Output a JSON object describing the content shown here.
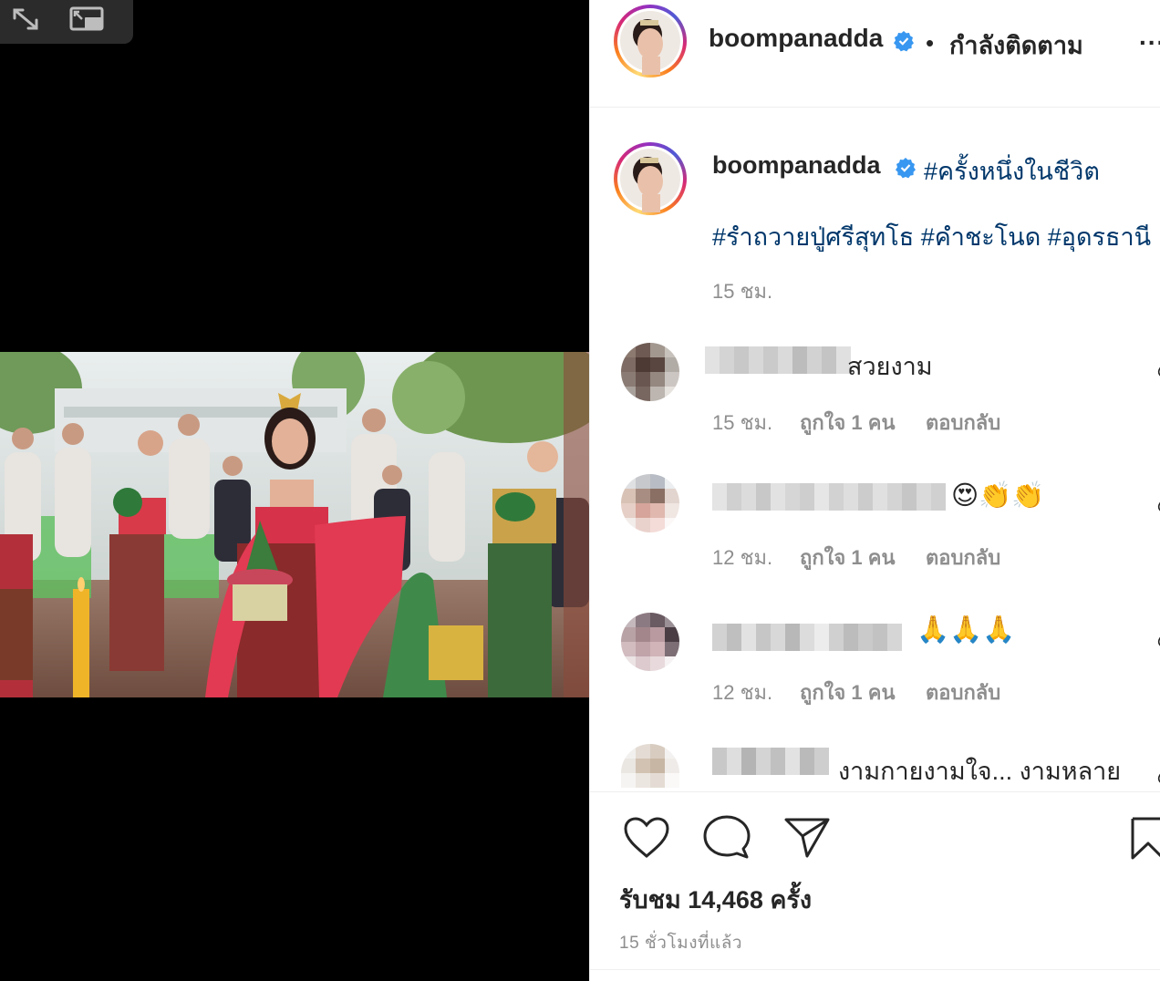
{
  "post": {
    "username": "boompanadda",
    "follow_separator": "•",
    "follow_status": "กำลังติดตาม",
    "more_label": "...",
    "caption_line1": "#ครั้งหนึ่งในชีวิต",
    "caption_line2": "#รำถวายปู่ศรีสุทโธ #คำชะโนด #อุดรธานี",
    "caption_time": "15 ชม."
  },
  "comments": [
    {
      "text": "สวยงาม",
      "time": "15 ชม.",
      "likes": "ถูกใจ 1 คน",
      "reply": "ตอบกลับ"
    },
    {
      "text": "😍👏👏",
      "time": "12 ชม.",
      "likes": "ถูกใจ 1 คน",
      "reply": "ตอบกลับ"
    },
    {
      "text": "🙏🙏🙏",
      "time": "12 ชม.",
      "likes": "ถูกใจ 1 คน",
      "reply": "ตอบกลับ"
    },
    {
      "text": "งามกายงามใจ... งามหลาย"
    }
  ],
  "footer": {
    "views": "รับชม 14,468 ครั้ง",
    "posted_ago": "15 ชั่วโมงที่แล้ว"
  },
  "icons": {
    "expand": "expand-icon",
    "pip": "picture-in-picture-icon",
    "like": "heart-icon",
    "comment": "comment-icon",
    "share": "send-icon",
    "save": "bookmark-icon",
    "verified": "verified-badge-icon"
  },
  "colors": {
    "hashtag": "#00376b",
    "verified": "#3897f0",
    "muted": "#8e8e8e",
    "text": "#262626"
  }
}
